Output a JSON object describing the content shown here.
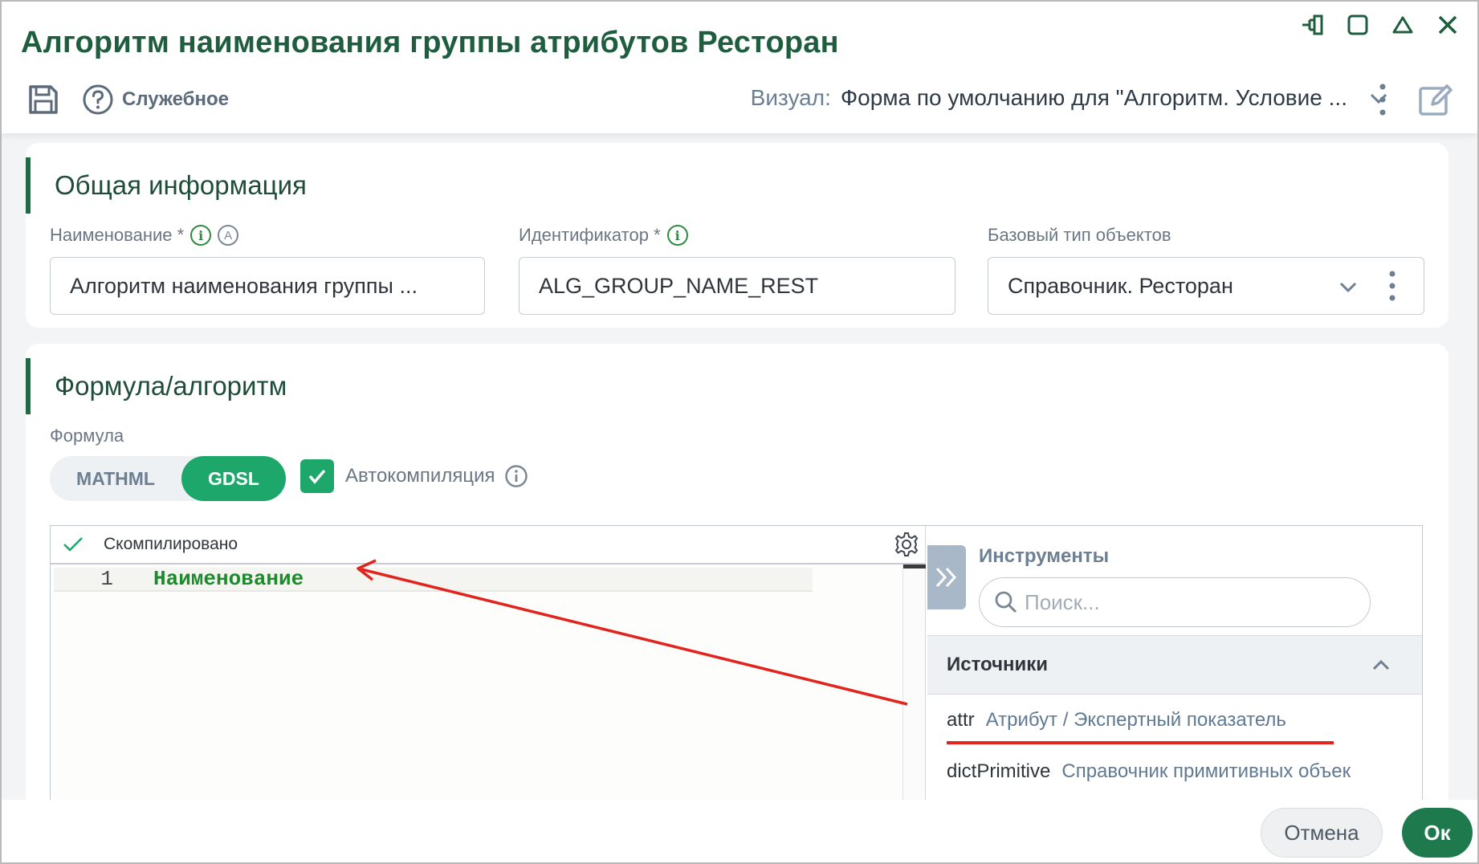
{
  "window": {
    "title": "Алгоритм наименования группы атрибутов Ресторан"
  },
  "toolbar": {
    "service_label": "Служебное",
    "visual_label": "Визуал:",
    "visual_value": "Форма по умолчанию для \"Алгоритм. Условие ..."
  },
  "general": {
    "section_title": "Общая информация",
    "name_label": "Наименование *",
    "name_value": "Алгоритм наименования группы ...",
    "id_label": "Идентификатор *",
    "id_value": "ALG_GROUP_NAME_REST",
    "base_type_label": "Базовый тип объектов",
    "base_type_value": "Справочник. Ресторан"
  },
  "formula": {
    "section_title": "Формула/алгоритм",
    "formula_label": "Формула",
    "mode_options": [
      "MATHML",
      "GDSL"
    ],
    "selected_mode": "GDSL",
    "autocompile_label": "Автокомпиляция",
    "autocompile_checked": true,
    "status_text": "Скомпилировано",
    "line_number": "1",
    "code_line": "Наименование"
  },
  "tools": {
    "title": "Инструменты",
    "search_placeholder": "Поиск...",
    "sources_title": "Источники",
    "sources": [
      {
        "key": "attr",
        "value": "Атрибут / Экспертный показатель"
      },
      {
        "key": "dictPrimitive",
        "value": "Справочник примитивных объек"
      }
    ]
  },
  "footer": {
    "cancel_label": "Отмена",
    "ok_label": "Ок"
  },
  "colors": {
    "brand_green": "#1f5d3f",
    "accent_green": "#1da76a",
    "ok_green": "#1e7a4d",
    "annotation_red": "#e2241e"
  }
}
